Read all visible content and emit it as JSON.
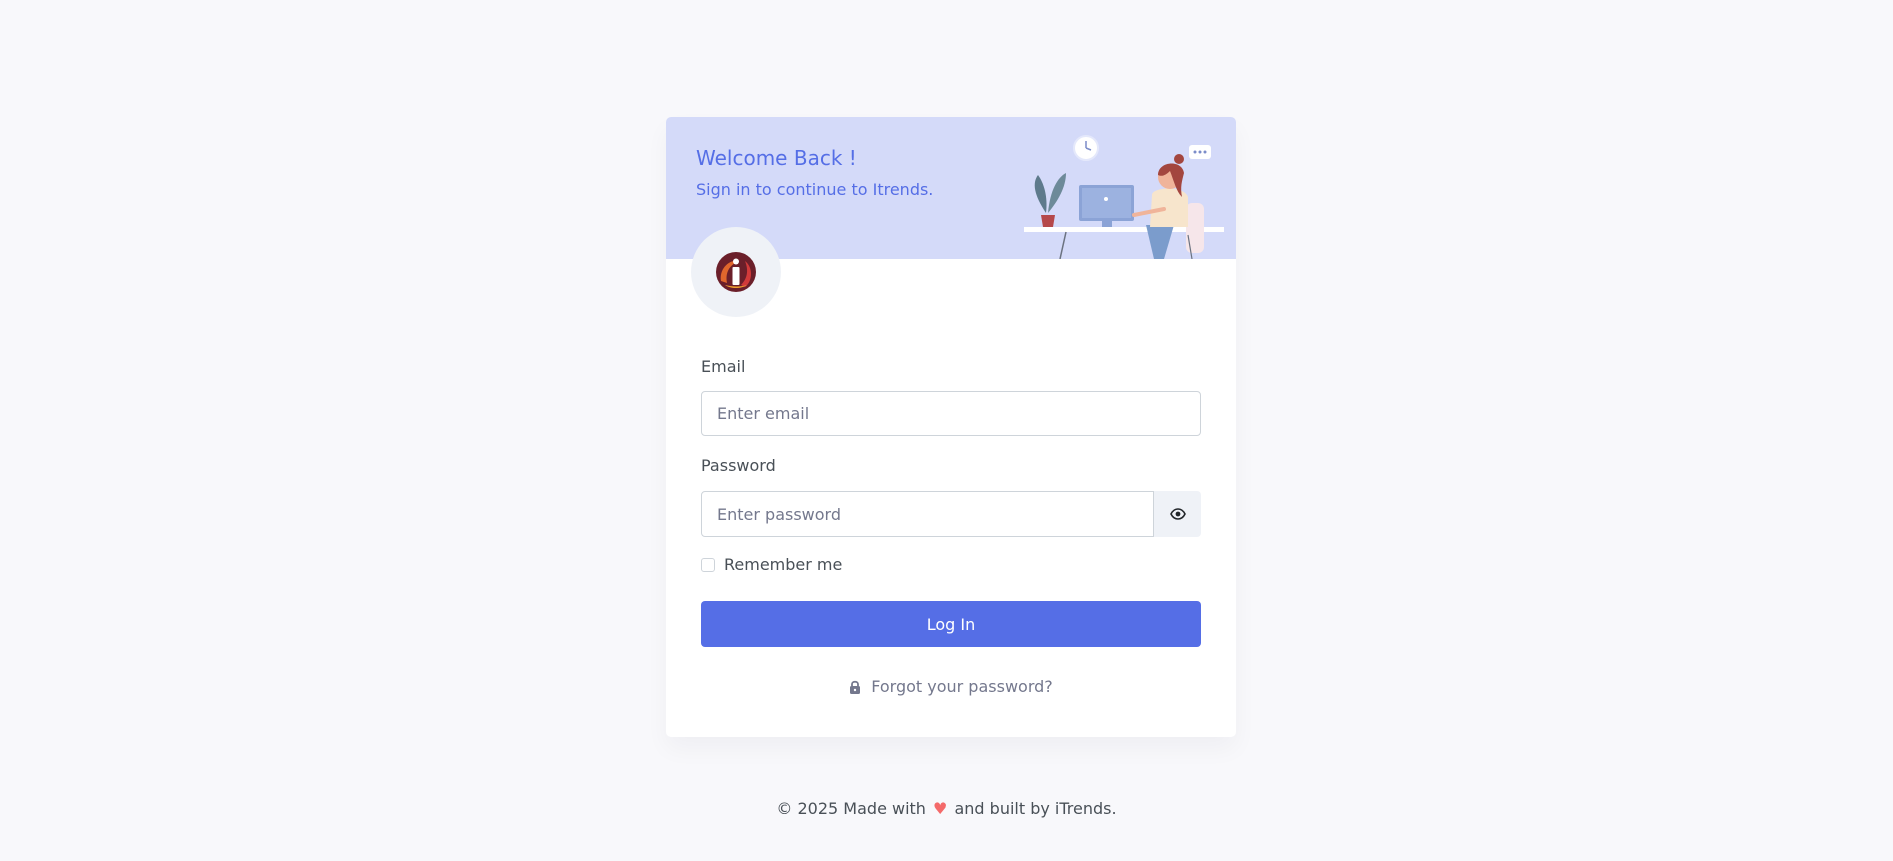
{
  "header": {
    "title": "Welcome Back !",
    "subtitle": "Sign in to continue to Itrends."
  },
  "form": {
    "email_label": "Email",
    "email_placeholder": "Enter email",
    "password_label": "Password",
    "password_placeholder": "Enter password",
    "remember_label": "Remember me",
    "login_label": "Log In",
    "forgot_label": "Forgot your password?"
  },
  "footer": {
    "prefix": "© 2025 Made with",
    "suffix": "and built by iTrends.",
    "heart_icon": "♥"
  },
  "icons": {
    "logo": "itrends-logo-icon",
    "eye": "eye-icon",
    "lock": "lock-icon",
    "heart": "heart-icon"
  },
  "colors": {
    "primary": "#556ee6",
    "header_bg": "#d4daf9",
    "page_bg": "#f8f8fb",
    "heart": "#f46a6a"
  }
}
